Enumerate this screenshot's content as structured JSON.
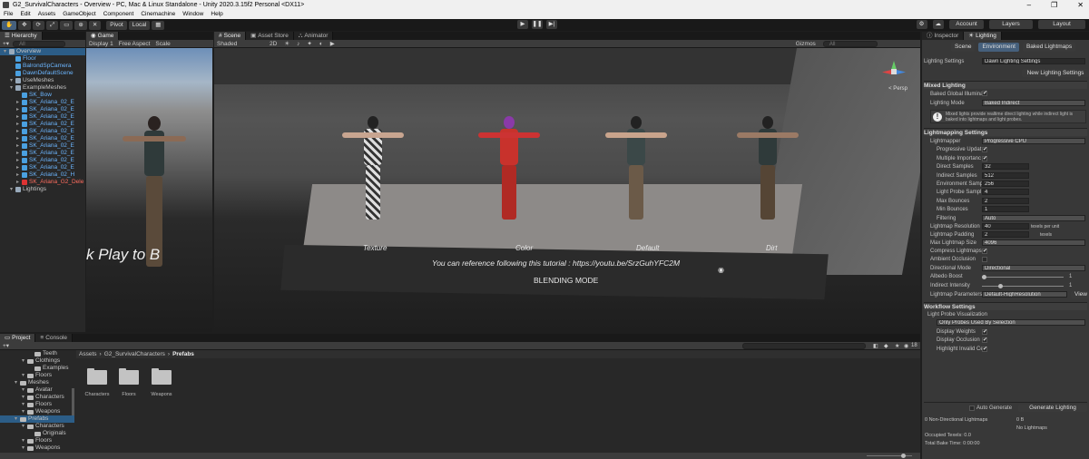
{
  "window": {
    "title": "G2_SurvivalCharacters - Overview - PC, Mac & Linux Standalone - Unity 2020.3.15f2 Personal <DX11>"
  },
  "menu": [
    "File",
    "Edit",
    "Assets",
    "GameObject",
    "Component",
    "Cinemachine",
    "Window",
    "Help"
  ],
  "toolbar": {
    "pivot": "Pivot",
    "local": "Local",
    "account": "Account",
    "layers": "Layers",
    "layout": "Layout"
  },
  "hierarchy": {
    "tab": "Hierarchy",
    "search_placeholder": "All",
    "items": [
      {
        "label": "Overview",
        "indent": 0,
        "color": "normal",
        "selected": true
      },
      {
        "label": "Floor",
        "indent": 1,
        "color": "blue"
      },
      {
        "label": "BalrondSpCamera",
        "indent": 1,
        "color": "blue"
      },
      {
        "label": "DawnDefaultScene",
        "indent": 1,
        "color": "blue"
      },
      {
        "label": "UseMeshes",
        "indent": 1,
        "color": "normal"
      },
      {
        "label": "ExampleMeshes",
        "indent": 1,
        "color": "normal"
      },
      {
        "label": "SK_Bow",
        "indent": 2,
        "color": "blue"
      },
      {
        "label": "SK_Ariana_02_E",
        "indent": 2,
        "color": "blue"
      },
      {
        "label": "SK_Ariana_02_E",
        "indent": 2,
        "color": "blue"
      },
      {
        "label": "SK_Ariana_02_E",
        "indent": 2,
        "color": "blue"
      },
      {
        "label": "SK_Ariana_02_E",
        "indent": 2,
        "color": "blue"
      },
      {
        "label": "SK_Ariana_02_E",
        "indent": 2,
        "color": "blue"
      },
      {
        "label": "SK_Ariana_02_E",
        "indent": 2,
        "color": "blue"
      },
      {
        "label": "SK_Ariana_02_E",
        "indent": 2,
        "color": "blue"
      },
      {
        "label": "SK_Ariana_02_E",
        "indent": 2,
        "color": "blue"
      },
      {
        "label": "SK_Ariana_02_E",
        "indent": 2,
        "color": "blue"
      },
      {
        "label": "SK_Ariana_02_E",
        "indent": 2,
        "color": "blue"
      },
      {
        "label": "SK_Ariana_02_H",
        "indent": 2,
        "color": "blue"
      },
      {
        "label": "SK_Ariana_G2_Dele",
        "indent": 2,
        "color": "red"
      },
      {
        "label": "Lightings",
        "indent": 1,
        "color": "normal"
      }
    ]
  },
  "game": {
    "tab": "Game",
    "display": "Display 1",
    "aspect": "Free Aspect",
    "scale": "Scale",
    "overlay_text": "k Play to B"
  },
  "scene": {
    "tabs": [
      "Scene",
      "Asset Store",
      "Animator"
    ],
    "shading": "Shaded",
    "twod": "2D",
    "gizmos": "Gizmos",
    "search_placeholder": "All",
    "persp": "< Persp",
    "labels": [
      "Texture",
      "Color",
      "Default",
      "Dirt"
    ],
    "tutorial": "You can reference following this tutorial : https://youtu.be/SrzGuhYFC2M",
    "blending": "BLENDING MODE"
  },
  "inspector": {
    "tabs": [
      "Inspector",
      "Lighting"
    ],
    "subtabs": [
      "Scene",
      "Environment",
      "Baked Lightmaps"
    ],
    "lighting_settings_label": "Lighting Settings",
    "lighting_settings_value": "Dawn Lighting Settings",
    "new_button": "New Lighting Settings",
    "mixed": {
      "title": "Mixed Lighting",
      "baked_gi": "Baked Global Illumina",
      "mode_label": "Lighting Mode",
      "mode_value": "Baked Indirect",
      "info": "Mixed lights provide realtime direct lighting while indirect light is baked into lightmaps and light probes."
    },
    "lightmapping": {
      "title": "Lightmapping Settings",
      "rows": [
        {
          "label": "Lightmapper",
          "value": "Progressive CPU",
          "type": "dd"
        },
        {
          "label": "Progressive Updat",
          "value": "✔",
          "type": "chk"
        },
        {
          "label": "Multiple Importanc",
          "value": "✔",
          "type": "chk"
        },
        {
          "label": "Direct Samples",
          "value": "32",
          "type": "val"
        },
        {
          "label": "Indirect Samples",
          "value": "512",
          "type": "val"
        },
        {
          "label": "Environment Samp",
          "value": "256",
          "type": "val"
        },
        {
          "label": "Light Probe Sampl",
          "value": "4",
          "type": "val"
        },
        {
          "label": "Max Bounces",
          "value": "2",
          "type": "val"
        },
        {
          "label": "Min Bounces",
          "value": "1",
          "type": "val"
        },
        {
          "label": "Filtering",
          "value": "Auto",
          "type": "dd"
        }
      ],
      "resolution_label": "Lightmap Resolution",
      "resolution_value": "40",
      "resolution_unit": "texels per unit",
      "padding_label": "Lightmap Padding",
      "padding_value": "2",
      "padding_unit": "texels",
      "maxsize_label": "Max Lightmap Size",
      "maxsize_value": "4096",
      "compress_label": "Compress Lightmaps",
      "compress_value": "✔",
      "ao_label": "Ambient Occlusion",
      "dirmode_label": "Directional Mode",
      "dirmode_value": "Directional",
      "albedo_label": "Albedo Boost",
      "albedo_value": "1",
      "indirect_label": "Indirect Intensity",
      "indirect_value": "1",
      "params_label": "Lightmap Parameters",
      "params_value": "Default-HighResolution",
      "view": "View"
    },
    "workflow": {
      "title": "Workflow Settings",
      "lpv": "Light Probe Visualization",
      "lpv_value": "Only Probes Used By Selection",
      "rows": [
        {
          "label": "Display Weights",
          "value": "✔"
        },
        {
          "label": "Display Occlusion",
          "value": "✔"
        },
        {
          "label": "Highlight Invalid Ce",
          "value": "✔"
        }
      ]
    },
    "auto_generate": "Auto Generate",
    "generate_button": "Generate Lighting",
    "stats": {
      "non_dir": "0 Non-Directional Lightmaps",
      "size": "0 B",
      "no_lightmaps": "No Lightmaps",
      "occupied": "Occupied Texels: 0.0",
      "bake_time": "Total Bake Time: 0:00:00"
    }
  },
  "project": {
    "tabs": [
      "Project",
      "Console"
    ],
    "badge": "18",
    "breadcrumb": [
      "Assets",
      "G2_SurvivalCharacters",
      "Prefabs"
    ],
    "tree": [
      {
        "label": "Teeth",
        "indent": 4
      },
      {
        "label": "Clothings",
        "indent": 3
      },
      {
        "label": "Examples",
        "indent": 4
      },
      {
        "label": "Floors",
        "indent": 3
      },
      {
        "label": "Meshes",
        "indent": 2
      },
      {
        "label": "Avatar",
        "indent": 3
      },
      {
        "label": "Characters",
        "indent": 3
      },
      {
        "label": "Floors",
        "indent": 3
      },
      {
        "label": "Weapons",
        "indent": 3
      },
      {
        "label": "Prefabs",
        "indent": 2,
        "selected": true
      },
      {
        "label": "Characters",
        "indent": 3
      },
      {
        "label": "Originals",
        "indent": 4
      },
      {
        "label": "Floors",
        "indent": 3
      },
      {
        "label": "Weapons",
        "indent": 3
      }
    ],
    "folders": [
      "Characters",
      "Floors",
      "Weapons"
    ]
  }
}
